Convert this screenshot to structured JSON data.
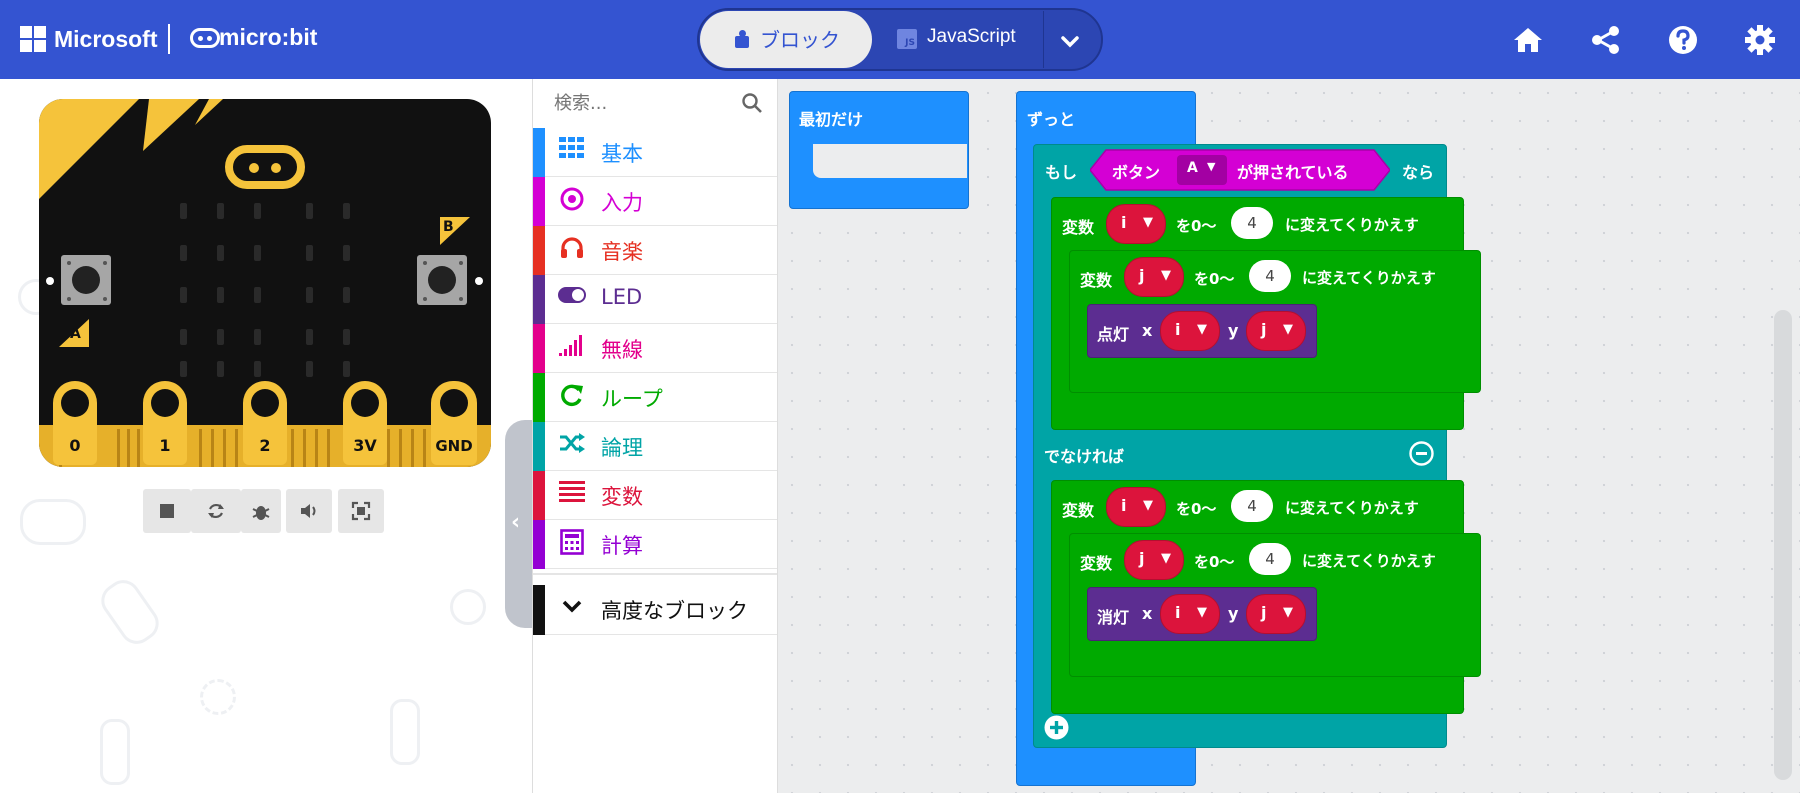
{
  "header": {
    "microsoft_label": "Microsoft",
    "microbit_label": "micro:bit",
    "tabs": [
      {
        "label": "ブロック",
        "active": true
      },
      {
        "label": "JavaScript",
        "active": false
      }
    ],
    "js_badge": "JS",
    "icons": [
      "home-icon",
      "share-icon",
      "help-icon",
      "settings-icon"
    ],
    "color": "#3454D1"
  },
  "simulator": {
    "pins": [
      "0",
      "1",
      "2",
      "3V",
      "GND"
    ],
    "button_labels": [
      "A",
      "B"
    ],
    "controls": [
      "stop-icon",
      "restart-icon",
      "debug-icon",
      "mute-icon",
      "fullscreen-icon"
    ]
  },
  "toolbox": {
    "search_placeholder": "検索...",
    "categories": [
      {
        "label": "基本",
        "color": "#1E90FF"
      },
      {
        "label": "入力",
        "color": "#D400D4"
      },
      {
        "label": "音楽",
        "color": "#E63022"
      },
      {
        "label": "LED",
        "color": "#5C2D91"
      },
      {
        "label": "無線",
        "color": "#E3008C"
      },
      {
        "label": "ループ",
        "color": "#00AA00"
      },
      {
        "label": "論理",
        "color": "#00A4A6"
      },
      {
        "label": "変数",
        "color": "#DC143C"
      },
      {
        "label": "計算",
        "color": "#9400D3"
      }
    ],
    "advanced": {
      "label": "高度なブロック",
      "color": "#111111"
    }
  },
  "workspace": {
    "on_start": "最初だけ",
    "forever": "ずっと",
    "if": "もし",
    "then": "なら",
    "button_text": "ボタン",
    "button_value": "A",
    "pressed_text": "が押されている",
    "else": "でなければ",
    "loop_var_label": "変数",
    "range_label": "を0～",
    "repeat_label": "に変えてくりかえす",
    "var_i": "i",
    "var_j": "j",
    "limit": "4",
    "plot": "点灯",
    "unplot": "消灯",
    "x_label": "x",
    "y_label": "y"
  }
}
